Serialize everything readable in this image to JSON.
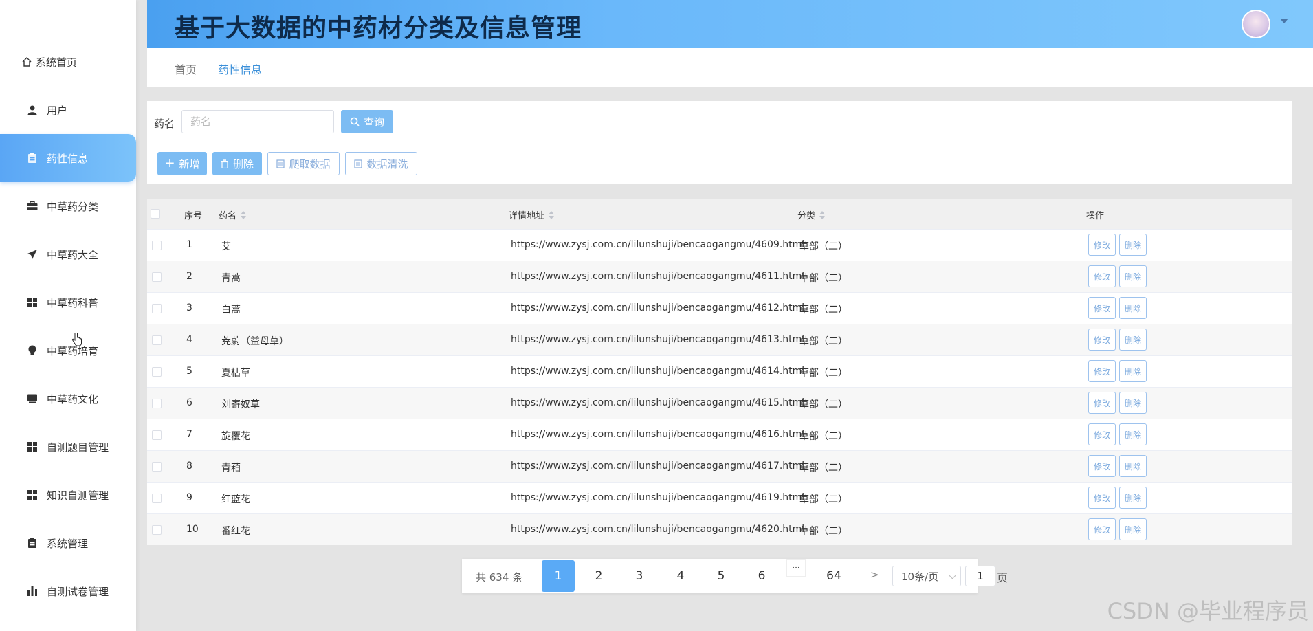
{
  "app": {
    "title": "基于大数据的中药材分类及信息管理"
  },
  "sidebar": {
    "items": [
      {
        "label": "系统首页",
        "icon": "home-icon"
      },
      {
        "label": "用户",
        "icon": "user-icon"
      },
      {
        "label": "药性信息",
        "icon": "clipboard-icon",
        "active": true
      },
      {
        "label": "中草药分类",
        "icon": "briefcase-icon"
      },
      {
        "label": "中草药大全",
        "icon": "paper-plane-icon"
      },
      {
        "label": "中草药科普",
        "icon": "grid-icon"
      },
      {
        "label": "中草药培育",
        "icon": "bulb-icon"
      },
      {
        "label": "中草药文化",
        "icon": "monitor-icon"
      },
      {
        "label": "自测题目管理",
        "icon": "grid-icon"
      },
      {
        "label": "知识自测管理",
        "icon": "grid-icon"
      },
      {
        "label": "系统管理",
        "icon": "clipboard-icon"
      },
      {
        "label": "自测试卷管理",
        "icon": "bar-chart-icon"
      }
    ]
  },
  "breadcrumb": {
    "home": "首页",
    "current": "药性信息"
  },
  "search": {
    "label": "药名",
    "placeholder": "药名",
    "value": "",
    "button": "查询"
  },
  "toolbar": {
    "add": "新增",
    "delete": "删除",
    "crawl": "爬取数据",
    "clean": "数据清洗"
  },
  "table": {
    "headers": {
      "index": "序号",
      "name": "药名",
      "url": "详情地址",
      "category": "分类",
      "actions": "操作"
    },
    "edit_label": "修改",
    "delete_label": "删除",
    "rows": [
      {
        "index": "1",
        "name": "艾",
        "url": "https://www.zysj.com.cn/lilunshuji/bencaogangmu/4609.html",
        "category": "草部（二）"
      },
      {
        "index": "2",
        "name": "青蒿",
        "url": "https://www.zysj.com.cn/lilunshuji/bencaogangmu/4611.html",
        "category": "草部（二）"
      },
      {
        "index": "3",
        "name": "白蒿",
        "url": "https://www.zysj.com.cn/lilunshuji/bencaogangmu/4612.html",
        "category": "草部（二）"
      },
      {
        "index": "4",
        "name": "茺蔚（益母草）",
        "url": "https://www.zysj.com.cn/lilunshuji/bencaogangmu/4613.html",
        "category": "草部（二）"
      },
      {
        "index": "5",
        "name": "夏枯草",
        "url": "https://www.zysj.com.cn/lilunshuji/bencaogangmu/4614.html",
        "category": "草部（二）"
      },
      {
        "index": "6",
        "name": "刘寄奴草",
        "url": "https://www.zysj.com.cn/lilunshuji/bencaogangmu/4615.html",
        "category": "草部（二）"
      },
      {
        "index": "7",
        "name": "旋覆花",
        "url": "https://www.zysj.com.cn/lilunshuji/bencaogangmu/4616.html",
        "category": "草部（二）"
      },
      {
        "index": "8",
        "name": "青葙",
        "url": "https://www.zysj.com.cn/lilunshuji/bencaogangmu/4617.html",
        "category": "草部（二）"
      },
      {
        "index": "9",
        "name": "红蓝花",
        "url": "https://www.zysj.com.cn/lilunshuji/bencaogangmu/4619.html",
        "category": "草部（二）"
      },
      {
        "index": "10",
        "name": "番红花",
        "url": "https://www.zysj.com.cn/lilunshuji/bencaogangmu/4620.html",
        "category": "草部（二）"
      }
    ]
  },
  "pagination": {
    "total": "共 634 条",
    "pages": [
      "1",
      "2",
      "3",
      "4",
      "5",
      "6"
    ],
    "current": "1",
    "ellipsis": "···",
    "last": "64",
    "next": ">",
    "page_size": "10条/页",
    "jump_value": "1",
    "jump_unit": "页"
  },
  "watermark": "CSDN @毕业程序员",
  "colors": {
    "accent": "#5aaaf6",
    "header_start": "#4aa0f0",
    "header_end": "#80c8fc",
    "title": "#0e2a4a"
  }
}
